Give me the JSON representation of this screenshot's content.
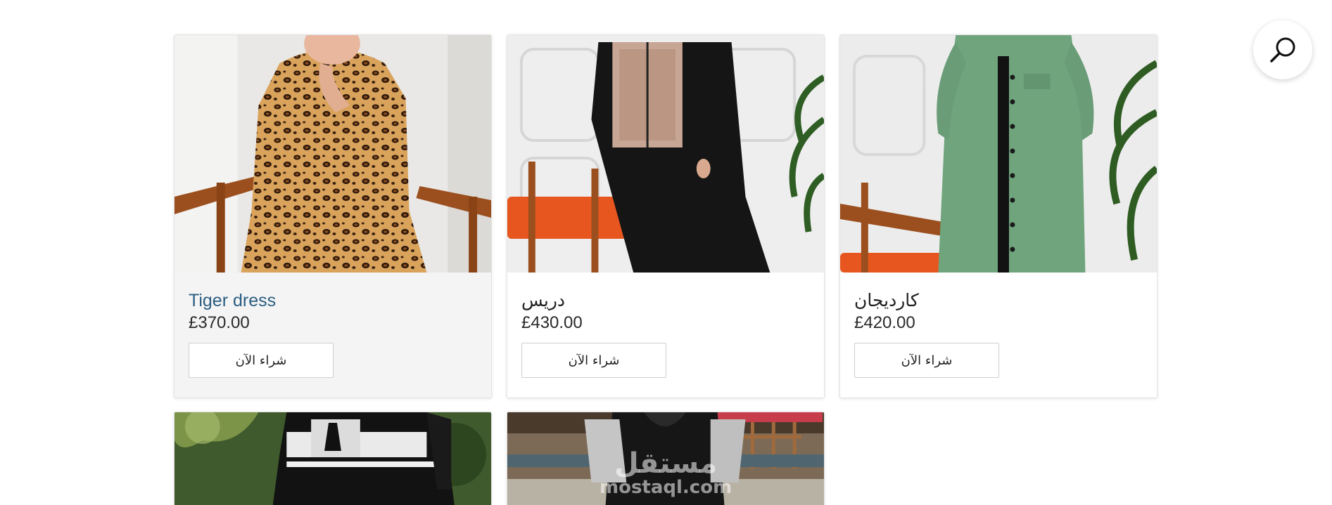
{
  "search": {
    "icon": "search-icon"
  },
  "products": [
    {
      "title": "Tiger dress",
      "price": "£370.00",
      "buy_label": "شراء الآن",
      "image": "leopard-print-dress-photo"
    },
    {
      "title": "دريس",
      "price": "£430.00",
      "buy_label": "شراء الآن",
      "image": "black-dress-with-patterned-panel-photo"
    },
    {
      "title": "كارديجان",
      "price": "£420.00",
      "buy_label": "شراء الآن",
      "image": "green-cardigan-photo"
    },
    {
      "image": "black-white-sport-dress-photo"
    },
    {
      "image": "black-hoodie-dress-photo"
    }
  ],
  "watermark": {
    "logo": "مستقل",
    "url": "mostaql.com"
  },
  "colors": {
    "title_link": "#2b5d82",
    "card_hover_bg": "#f4f4f4",
    "border": "#e3e3e3"
  }
}
